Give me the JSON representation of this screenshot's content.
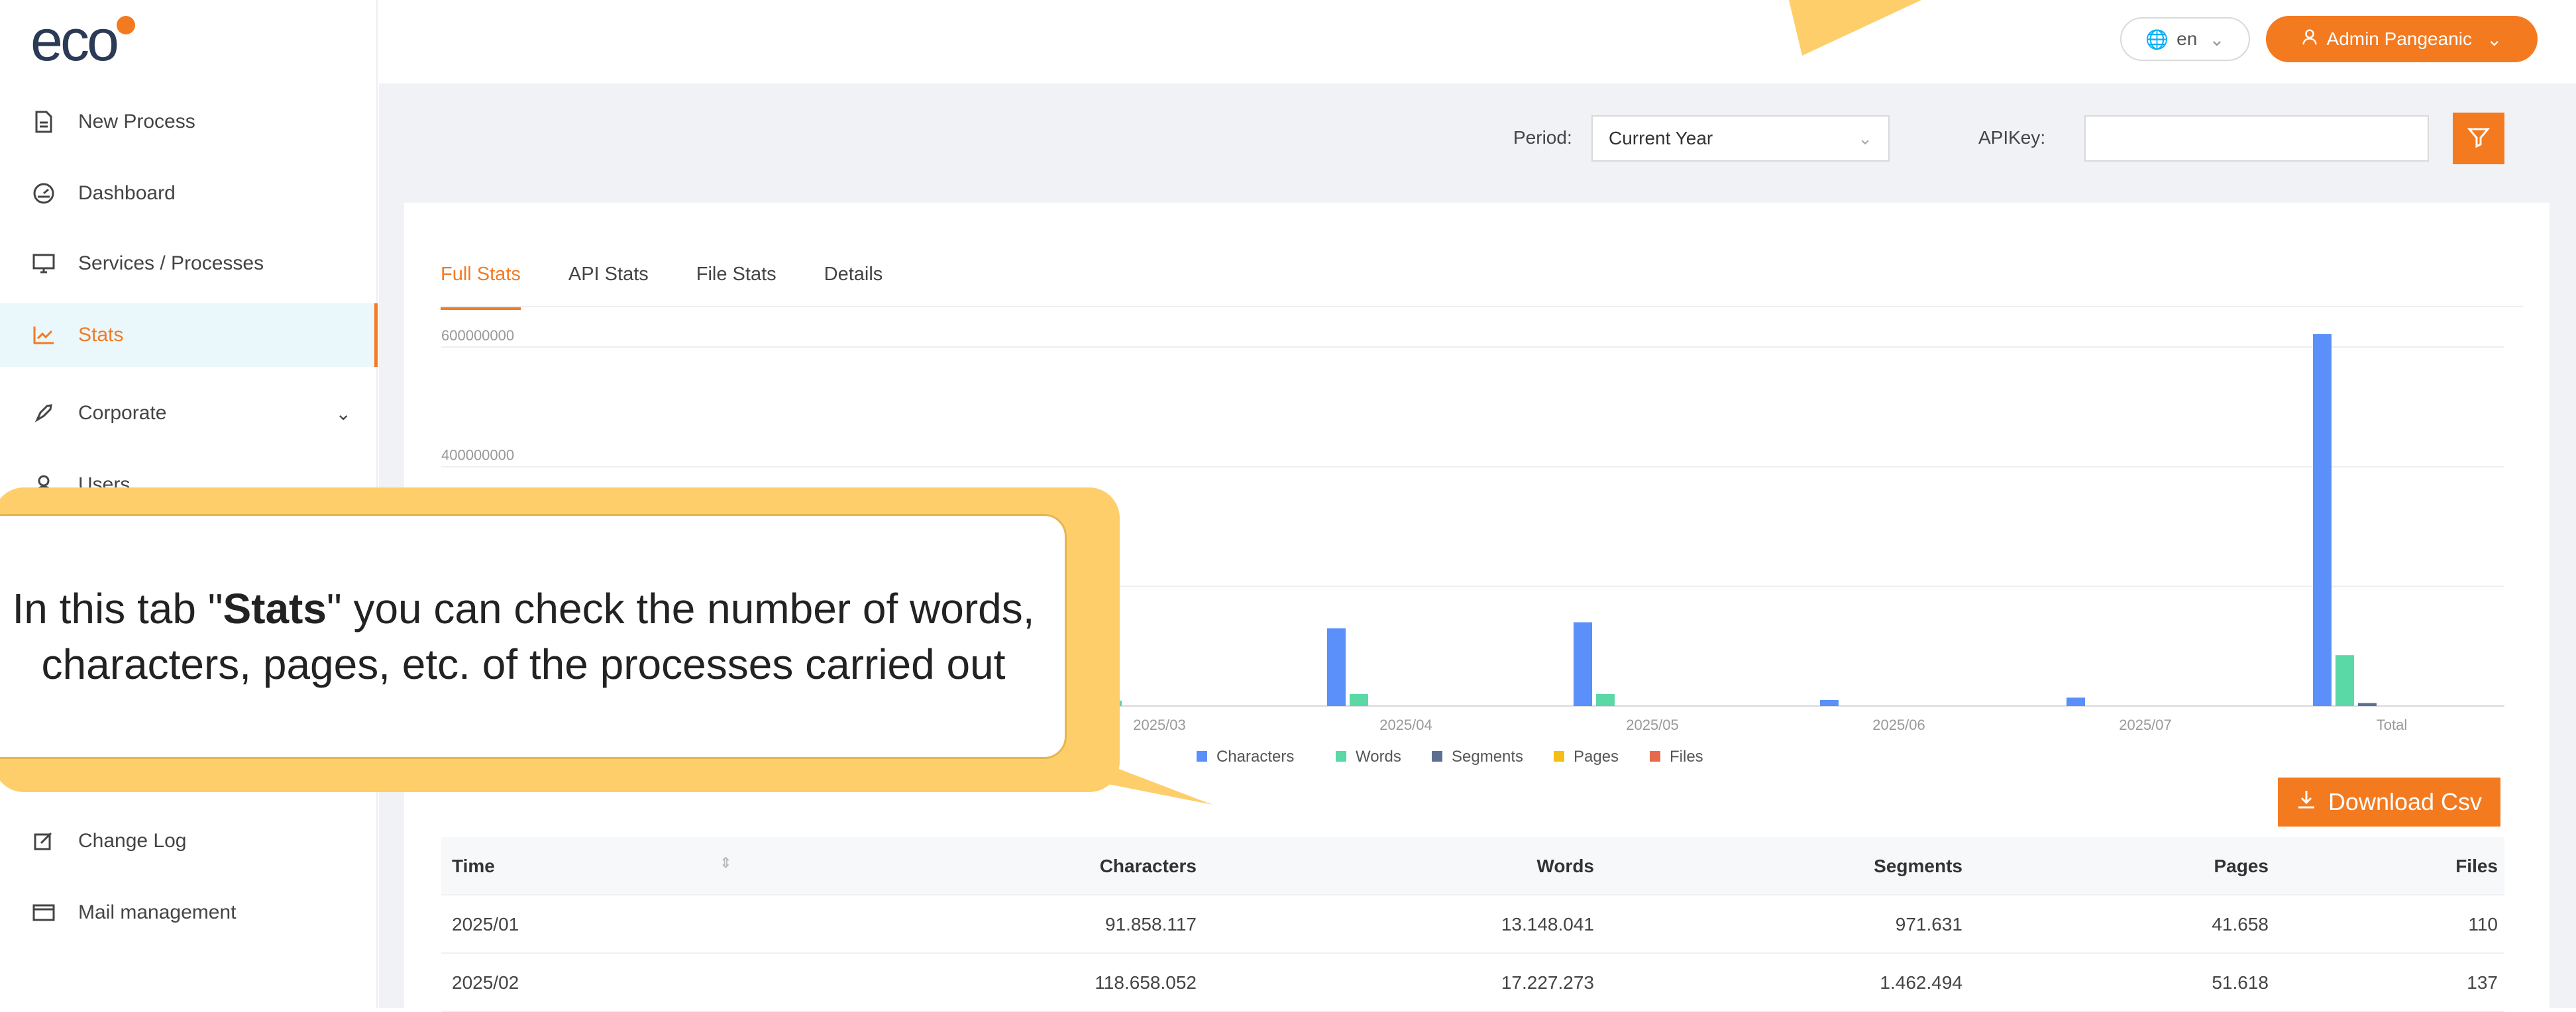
{
  "logo": "eco",
  "sidebar": {
    "items": [
      {
        "label": "New Process",
        "icon": "file-icon"
      },
      {
        "label": "Dashboard",
        "icon": "dashboard-icon"
      },
      {
        "label": "Services / Processes",
        "icon": "monitor-icon"
      },
      {
        "label": "Stats",
        "icon": "chart-line-icon",
        "active": true
      },
      {
        "label": "Corporate",
        "icon": "rocket-icon"
      },
      {
        "label": "Users",
        "icon": "user-icon"
      },
      {
        "label": "Change Log",
        "icon": "edit-icon"
      },
      {
        "label": "Mail management",
        "icon": "mail-icon"
      }
    ]
  },
  "topbar": {
    "lang": "en",
    "user": "Admin Pangeanic"
  },
  "filters": {
    "period_label": "Period:",
    "period_value": "Current Year",
    "apikey_label": "APIKey:"
  },
  "tabs": [
    "Full Stats",
    "API Stats",
    "File Stats",
    "Details"
  ],
  "chart_data": {
    "type": "bar",
    "categories": [
      "2025/03",
      "2025/04",
      "2025/05",
      "2025/06",
      "2025/07",
      "Total"
    ],
    "series": [
      {
        "name": "Characters",
        "color": "#5b8ff9",
        "values": [
          0,
          130000000,
          140000000,
          10000000,
          14000000,
          622000000
        ]
      },
      {
        "name": "Words",
        "color": "#5ad8a6",
        "values": [
          9000000,
          20000000,
          20000000,
          0,
          0,
          85000000
        ]
      },
      {
        "name": "Segments",
        "color": "#5d7092",
        "values": [
          0,
          0,
          0,
          0,
          0,
          5000000
        ]
      },
      {
        "name": "Pages",
        "color": "#f6bd16",
        "values": [
          0,
          0,
          0,
          0,
          0,
          0
        ]
      },
      {
        "name": "Files",
        "color": "#e8684a",
        "values": [
          0,
          0,
          0,
          0,
          0,
          0
        ]
      }
    ],
    "y_ticks": [
      "600000000",
      "400000000"
    ],
    "ylim": [
      0,
      640000000
    ],
    "grid": true,
    "legend": "bottom-center"
  },
  "download_label": "Download Csv",
  "table": {
    "headers": [
      "Time",
      "Characters",
      "Words",
      "Segments",
      "Pages",
      "Files"
    ],
    "rows": [
      [
        "2025/01",
        "91.858.117",
        "13.148.041",
        "971.631",
        "41.658",
        "110"
      ],
      [
        "2025/02",
        "118.658.052",
        "17.227.273",
        "1.462.494",
        "51.618",
        "137"
      ]
    ]
  },
  "callout": {
    "before": "In this tab \"",
    "bold": "Stats",
    "after": "\" you can check the number of words, characters, pages, etc. of the processes carried out"
  }
}
